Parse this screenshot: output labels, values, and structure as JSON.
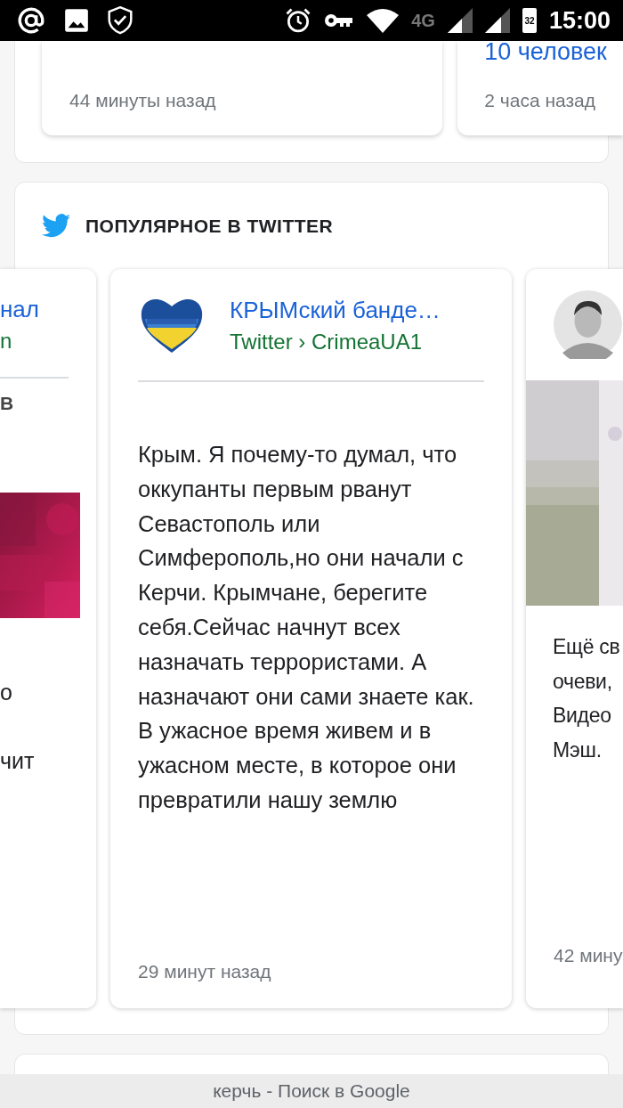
{
  "status_bar": {
    "network": "4G",
    "battery": "32",
    "time": "15:00"
  },
  "top_cards": [
    {
      "time": "44 минуты назад"
    },
    {
      "title": "10 человек",
      "time": "2 часа назад"
    }
  ],
  "twitter_section": {
    "heading": "ПОПУЛЯРНОЕ В TWITTER",
    "left_card": {
      "title": "нал",
      "source": "n",
      "label": "В",
      "text_lines": [
        "о",
        "чит"
      ]
    },
    "main_card": {
      "title": "КРЫМский банде…",
      "source": "Twitter › CrimeaUA1",
      "text": "Крым. Я почему-то думал, что оккупанты первым рванут Севастополь или Симферополь,но они начали с Керчи. Крымчане, берегите себя.Сейчас начнут всех назначать террористами. А назначают они сами знаете как. В ужасное время живем и в ужасном месте, в которое они превратили нашу землю",
      "time": "29 минут назад"
    },
    "right_card": {
      "text_lines": [
        "Ещё св",
        "очеви,",
        "Видео",
        "Мэш."
      ],
      "time": "42 мину"
    }
  },
  "bottom_bar": {
    "text": "керчь - Поиск в Google"
  }
}
